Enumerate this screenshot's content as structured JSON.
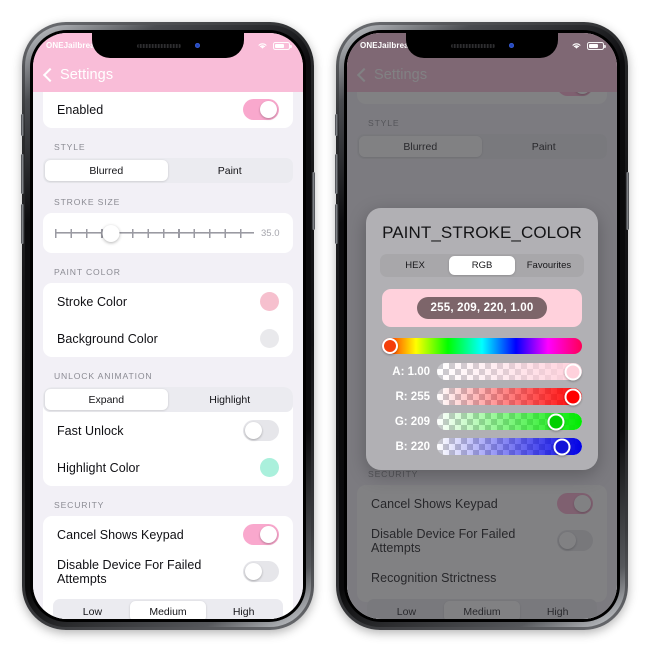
{
  "statusbar": {
    "carrier": "ONEJailbreak",
    "wifi_icon": "wifi-icon",
    "battery_icon": "battery-icon"
  },
  "navbar": {
    "back_icon": "chevron-left-icon",
    "title": "Settings"
  },
  "settings": {
    "enabled_row": {
      "label": "Enabled",
      "state": "on"
    },
    "style": {
      "header": "STYLE",
      "options": [
        "Blurred",
        "Paint"
      ],
      "selected": "Blurred"
    },
    "stroke_size": {
      "header": "STROKE SIZE",
      "value": "35.0",
      "value_clipped": "35.0",
      "knob_percent": 28
    },
    "paint_color": {
      "header": "PAINT COLOR",
      "rows": [
        {
          "label": "Stroke Color",
          "swatch": "#f6c0ce"
        },
        {
          "label": "Background Color",
          "swatch": "#e9e9ec"
        }
      ]
    },
    "unlock_animation": {
      "header": "UNLOCK ANIMATION",
      "options": [
        "Expand",
        "Highlight"
      ],
      "selected": "Expand",
      "rows": [
        {
          "label": "Fast Unlock",
          "state": "off"
        },
        {
          "label": "Highlight Color",
          "swatch": "#aaf0dc"
        }
      ]
    },
    "security": {
      "header": "SECURITY",
      "rows": [
        {
          "label": "Cancel Shows Keypad",
          "state": "on"
        },
        {
          "label": "Disable Device For Failed Attempts",
          "state": "off"
        },
        {
          "label": "Recognition Strictness"
        }
      ],
      "strictness_options": [
        "Low",
        "Medium",
        "High"
      ],
      "strictness_selected": "Medium"
    }
  },
  "color_picker": {
    "title": "PAINT_STROKE_COLOR",
    "tabs": [
      "HEX",
      "RGB",
      "Favourites"
    ],
    "selected_tab": "RGB",
    "preview_value": "255, 209, 220, 1.00",
    "preview_color": "#ffd1dc",
    "hue_knob_color": "#f43e0a",
    "channels": [
      {
        "label": "A: 1.00",
        "name": "alpha",
        "value": 1.0,
        "percent": 100,
        "knob_color": "#ffd1dc",
        "ramp_to": "#ffd1dc"
      },
      {
        "label": "R: 255",
        "name": "red",
        "value": 255,
        "percent": 100,
        "knob_color": "#ff0000",
        "ramp_to": "#ff0000"
      },
      {
        "label": "G: 209",
        "name": "green",
        "value": 209,
        "percent": 82,
        "knob_color": "#00e000",
        "ramp_to": "#00ff00"
      },
      {
        "label": "B: 220",
        "name": "blue",
        "value": 220,
        "percent": 86,
        "knob_color": "#1b1bdd",
        "ramp_to": "#0000ff"
      }
    ]
  },
  "colors": {
    "nav_pink": "#f9bdd8",
    "toggle_on": "#f9a8cd",
    "toggle_off": "#e6e6ea",
    "page_bg": "#f2f0f6",
    "dim_overlay": "rgba(52,52,55,.62)"
  }
}
